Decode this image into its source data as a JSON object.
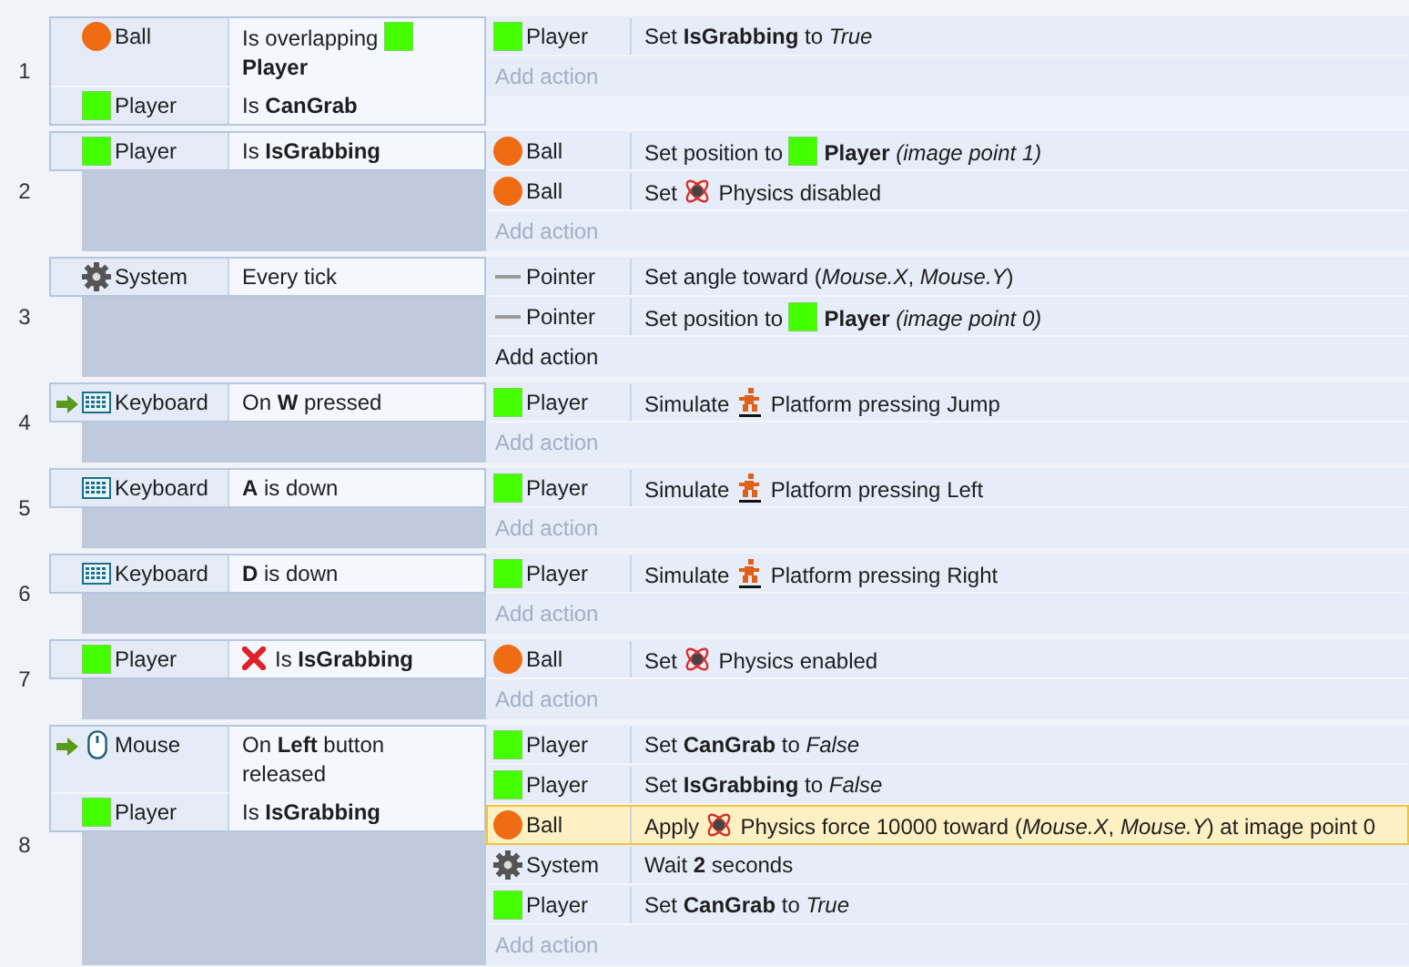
{
  "events": [
    {
      "number": "1",
      "conditions": [
        {
          "object": {
            "name": "Ball",
            "kind": "ball",
            "trigger": false
          },
          "inverted": false,
          "segments": [
            {
              "kind": "text",
              "text": "Is overlapping "
            },
            {
              "kind": "sprite"
            },
            {
              "kind": "text",
              "text": " **Player**"
            }
          ]
        },
        {
          "object": {
            "name": "Player",
            "kind": "sprite",
            "trigger": false
          },
          "inverted": false,
          "segments": [
            {
              "kind": "text",
              "text": "Is **CanGrab**"
            }
          ]
        }
      ],
      "actions": [
        {
          "object": {
            "name": "Player",
            "kind": "sprite"
          },
          "selected": false,
          "segments": [
            {
              "kind": "text",
              "text": "Set **IsGrabbing** to *True*"
            }
          ]
        }
      ],
      "add_action": {
        "label": "Add action",
        "active": false
      }
    },
    {
      "number": "2",
      "conditions": [
        {
          "object": {
            "name": "Player",
            "kind": "sprite",
            "trigger": false
          },
          "inverted": false,
          "segments": [
            {
              "kind": "text",
              "text": "Is **IsGrabbing**"
            }
          ]
        }
      ],
      "actions": [
        {
          "object": {
            "name": "Ball",
            "kind": "ball"
          },
          "selected": false,
          "segments": [
            {
              "kind": "text",
              "text": "Set position to "
            },
            {
              "kind": "sprite"
            },
            {
              "kind": "text",
              "text": " **Player** *(image point 1)*"
            }
          ]
        },
        {
          "object": {
            "name": "Ball",
            "kind": "ball"
          },
          "selected": false,
          "segments": [
            {
              "kind": "text",
              "text": "Set "
            },
            {
              "kind": "physics"
            },
            {
              "kind": "text",
              "text": " Physics disabled"
            }
          ]
        }
      ],
      "add_action": {
        "label": "Add action",
        "active": false
      }
    },
    {
      "number": "3",
      "conditions": [
        {
          "object": {
            "name": "System",
            "kind": "system",
            "trigger": false
          },
          "inverted": false,
          "segments": [
            {
              "kind": "text",
              "text": "Every tick"
            }
          ]
        }
      ],
      "actions": [
        {
          "object": {
            "name": "Pointer",
            "kind": "pointer"
          },
          "selected": false,
          "segments": [
            {
              "kind": "text",
              "text": "Set angle toward (*Mouse.X*, *Mouse.Y*)"
            }
          ]
        },
        {
          "object": {
            "name": "Pointer",
            "kind": "pointer"
          },
          "selected": false,
          "segments": [
            {
              "kind": "text",
              "text": "Set position to "
            },
            {
              "kind": "sprite"
            },
            {
              "kind": "text",
              "text": " **Player** *(image point 0)*"
            }
          ]
        }
      ],
      "add_action": {
        "label": "Add action",
        "active": true
      }
    },
    {
      "number": "4",
      "conditions": [
        {
          "object": {
            "name": "Keyboard",
            "kind": "keyboard",
            "trigger": true
          },
          "inverted": false,
          "segments": [
            {
              "kind": "text",
              "text": "On **W** pressed"
            }
          ]
        }
      ],
      "actions": [
        {
          "object": {
            "name": "Player",
            "kind": "sprite"
          },
          "selected": false,
          "segments": [
            {
              "kind": "text",
              "text": "Simulate "
            },
            {
              "kind": "platform"
            },
            {
              "kind": "text",
              "text": " Platform pressing Jump"
            }
          ]
        }
      ],
      "add_action": {
        "label": "Add action",
        "active": false
      }
    },
    {
      "number": "5",
      "conditions": [
        {
          "object": {
            "name": "Keyboard",
            "kind": "keyboard",
            "trigger": false
          },
          "inverted": false,
          "segments": [
            {
              "kind": "text",
              "text": "**A** is down"
            }
          ]
        }
      ],
      "actions": [
        {
          "object": {
            "name": "Player",
            "kind": "sprite"
          },
          "selected": false,
          "segments": [
            {
              "kind": "text",
              "text": "Simulate "
            },
            {
              "kind": "platform"
            },
            {
              "kind": "text",
              "text": " Platform pressing Left"
            }
          ]
        }
      ],
      "add_action": {
        "label": "Add action",
        "active": false
      }
    },
    {
      "number": "6",
      "conditions": [
        {
          "object": {
            "name": "Keyboard",
            "kind": "keyboard",
            "trigger": false
          },
          "inverted": false,
          "segments": [
            {
              "kind": "text",
              "text": "**D** is down"
            }
          ]
        }
      ],
      "actions": [
        {
          "object": {
            "name": "Player",
            "kind": "sprite"
          },
          "selected": false,
          "segments": [
            {
              "kind": "text",
              "text": "Simulate "
            },
            {
              "kind": "platform"
            },
            {
              "kind": "text",
              "text": " Platform pressing Right"
            }
          ]
        }
      ],
      "add_action": {
        "label": "Add action",
        "active": false
      }
    },
    {
      "number": "7",
      "conditions": [
        {
          "object": {
            "name": "Player",
            "kind": "sprite",
            "trigger": false
          },
          "inverted": true,
          "segments": [
            {
              "kind": "text",
              "text": "Is **IsGrabbing**"
            }
          ]
        }
      ],
      "actions": [
        {
          "object": {
            "name": "Ball",
            "kind": "ball"
          },
          "selected": false,
          "segments": [
            {
              "kind": "text",
              "text": "Set "
            },
            {
              "kind": "physics"
            },
            {
              "kind": "text",
              "text": " Physics enabled"
            }
          ]
        }
      ],
      "add_action": {
        "label": "Add action",
        "active": false
      }
    },
    {
      "number": "8",
      "conditions": [
        {
          "object": {
            "name": "Mouse",
            "kind": "mouse",
            "trigger": true
          },
          "inverted": false,
          "segments": [
            {
              "kind": "text",
              "text": "On **Left** button released"
            }
          ]
        },
        {
          "object": {
            "name": "Player",
            "kind": "sprite",
            "trigger": false
          },
          "inverted": false,
          "segments": [
            {
              "kind": "text",
              "text": "Is **IsGrabbing**"
            }
          ]
        }
      ],
      "actions": [
        {
          "object": {
            "name": "Player",
            "kind": "sprite"
          },
          "selected": false,
          "segments": [
            {
              "kind": "text",
              "text": "Set **CanGrab** to *False*"
            }
          ]
        },
        {
          "object": {
            "name": "Player",
            "kind": "sprite"
          },
          "selected": false,
          "segments": [
            {
              "kind": "text",
              "text": "Set **IsGrabbing** to *False*"
            }
          ]
        },
        {
          "object": {
            "name": "Ball",
            "kind": "ball"
          },
          "selected": true,
          "segments": [
            {
              "kind": "text",
              "text": "Apply "
            },
            {
              "kind": "physics"
            },
            {
              "kind": "text",
              "text": " Physics force 10000 toward (*Mouse.X*, *Mouse.Y*) at image point 0"
            }
          ]
        },
        {
          "object": {
            "name": "System",
            "kind": "system"
          },
          "selected": false,
          "segments": [
            {
              "kind": "text",
              "text": "Wait **2** seconds"
            }
          ]
        },
        {
          "object": {
            "name": "Player",
            "kind": "sprite"
          },
          "selected": false,
          "segments": [
            {
              "kind": "text",
              "text": "Set **CanGrab** to *True*"
            }
          ]
        }
      ],
      "add_action": {
        "label": "Add action",
        "active": false
      }
    }
  ]
}
